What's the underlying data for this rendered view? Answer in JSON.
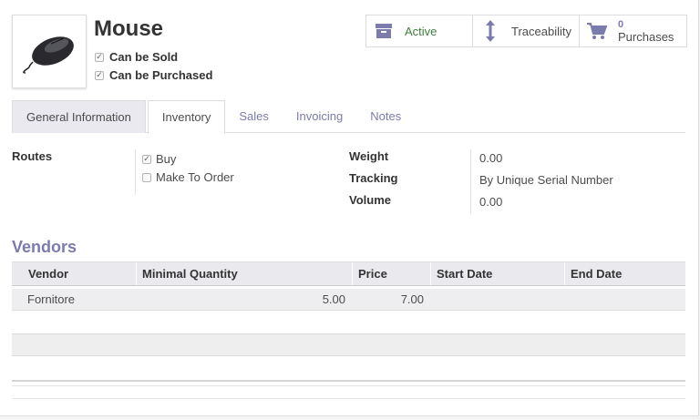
{
  "product": {
    "name": "Mouse",
    "options": [
      {
        "label": "Can be Sold",
        "checked": true
      },
      {
        "label": "Can be Purchased",
        "checked": true
      }
    ]
  },
  "smart_buttons": {
    "active": {
      "label": "Active",
      "icon": "archive-icon",
      "color": "#3d7d3d"
    },
    "traceability": {
      "label": "Traceability",
      "icon": "up-down-arrow-icon"
    },
    "purchases": {
      "count": "0",
      "label": "Purchases",
      "icon": "cart-icon"
    }
  },
  "tabs": [
    "General Information",
    "Inventory",
    "Sales",
    "Invoicing",
    "Notes"
  ],
  "active_tab": "Inventory",
  "inventory": {
    "routes_label": "Routes",
    "routes": [
      {
        "label": "Buy",
        "checked": true
      },
      {
        "label": "Make To Order",
        "checked": false
      }
    ],
    "weight_label": "Weight",
    "weight_value": "0.00",
    "tracking_label": "Tracking",
    "tracking_value": "By Unique Serial Number",
    "volume_label": "Volume",
    "volume_value": "0.00"
  },
  "vendors": {
    "title": "Vendors",
    "columns": [
      "Vendor",
      "Minimal Quantity",
      "Price",
      "Start Date",
      "End Date"
    ],
    "rows": [
      {
        "vendor": "Fornitore",
        "min_qty": "5.00",
        "price": "7.00",
        "start_date": "",
        "end_date": ""
      }
    ]
  },
  "colors": {
    "accent": "#7c7bad",
    "header_bg": "#e9e9ee"
  }
}
